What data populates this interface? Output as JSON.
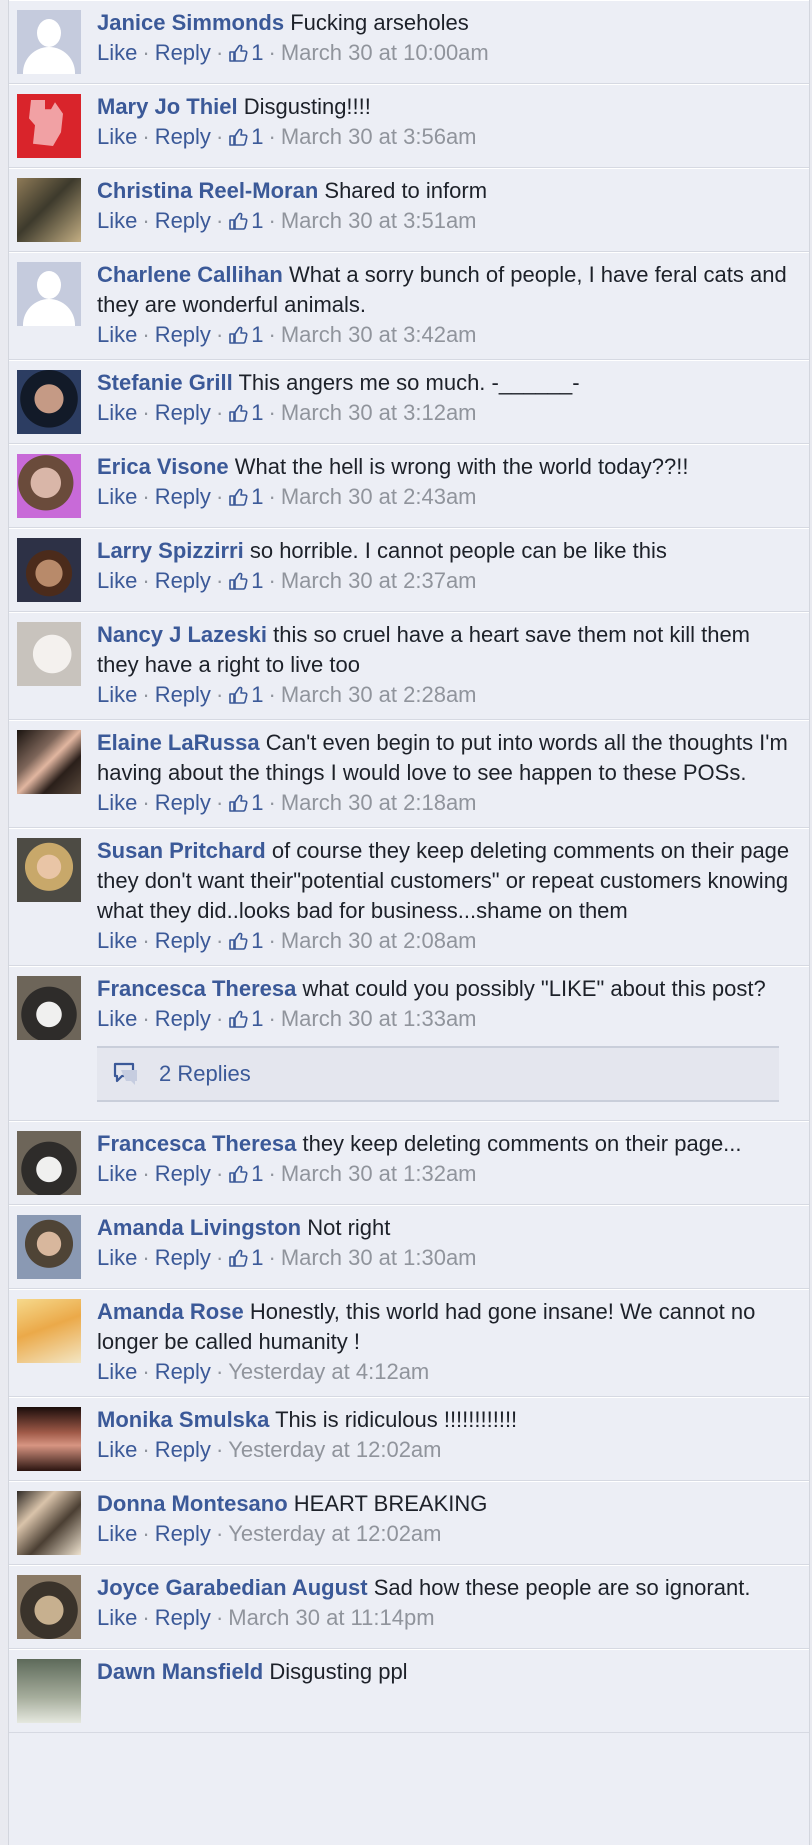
{
  "labels": {
    "like": "Like",
    "reply": "Reply",
    "separator": "·"
  },
  "comments": [
    {
      "name": "Janice Simmonds",
      "text": "Fucking arseholes",
      "likes": "1",
      "time": "March 30 at 10:00am",
      "avatar": "default-avatar"
    },
    {
      "name": "Mary Jo Thiel",
      "text": "Disgusting!!!!",
      "likes": "1",
      "time": "March 30 at 3:56am",
      "avatar": "red-equality-avatar"
    },
    {
      "name": "Christina Reel-Moran",
      "text": "Shared to inform",
      "likes": "1",
      "time": "March 30 at 3:51am",
      "avatar": "couple-photo-avatar"
    },
    {
      "name": "Charlene Callihan",
      "text": "What a sorry bunch of people, I have feral cats and they are wonderful animals.",
      "likes": "1",
      "time": "March 30 at 3:42am",
      "avatar": "default-avatar"
    },
    {
      "name": "Stefanie Grill",
      "text": "This angers me so much. -______-",
      "likes": "1",
      "time": "March 30 at 3:12am",
      "avatar": "woman-photo-avatar"
    },
    {
      "name": "Erica Visone",
      "text": "What the hell is wrong with the world today??!!",
      "likes": "1",
      "time": "March 30 at 2:43am",
      "avatar": "woman-photo-avatar"
    },
    {
      "name": "Larry Spizzirri",
      "text": "so horrible. I cannot people can be like this",
      "likes": "1",
      "time": "March 30 at 2:37am",
      "avatar": "man-photo-avatar"
    },
    {
      "name": "Nancy J Lazeski",
      "text": "this so cruel have a heart save them not kill them they have a right to live too",
      "likes": "1",
      "time": "March 30 at 2:28am",
      "avatar": "dog-photo-avatar"
    },
    {
      "name": "Elaine LaRussa",
      "text": "Can't even begin to put into words all the thoughts I'm having about the things I would love to see happen to these POSs.",
      "likes": "1",
      "time": "March 30 at 2:18am",
      "avatar": "woman-photo-avatar"
    },
    {
      "name": "Susan Pritchard",
      "text": "of course they keep deleting comments on their page they don't want their\"potential customers\" or repeat customers knowing what they did..looks bad for business...shame on them",
      "likes": "1",
      "time": "March 30 at 2:08am",
      "avatar": "woman-photo-avatar"
    },
    {
      "name": "Francesca Theresa",
      "text": "what could you possibly \"LIKE\" about this post?",
      "likes": "1",
      "time": "March 30 at 1:33am",
      "avatar": "cat-photo-avatar",
      "replies": "2 Replies"
    },
    {
      "name": "Francesca Theresa",
      "text": "they keep deleting comments on their page...",
      "likes": "1",
      "time": "March 30 at 1:32am",
      "avatar": "cat-photo-avatar"
    },
    {
      "name": "Amanda Livingston",
      "text": "Not right",
      "likes": "1",
      "time": "March 30 at 1:30am",
      "avatar": "woman-photo-avatar"
    },
    {
      "name": "Amanda Rose",
      "text": "Honestly, this world had gone insane! We cannot no longer be called humanity !",
      "likes": "",
      "time": "Yesterday at 4:12am",
      "avatar": "book-cover-avatar"
    },
    {
      "name": "Monika Smulska",
      "text": "This is ridiculous !!!!!!!!!!!!",
      "likes": "",
      "time": "Yesterday at 12:02am",
      "avatar": "woman-photo-avatar"
    },
    {
      "name": "Donna Montesano",
      "text": "HEART BREAKING",
      "likes": "",
      "time": "Yesterday at 12:02am",
      "avatar": "group-photo-avatar"
    },
    {
      "name": "Joyce Garabedian August",
      "text": "Sad how these people are so ignorant.",
      "likes": "",
      "time": "March 30 at 11:14pm",
      "avatar": "cat-photo-avatar"
    },
    {
      "name": "Dawn Mansfield",
      "text": "Disgusting ppl",
      "likes": "",
      "time": "",
      "avatar": "landscape-photo-avatar"
    }
  ]
}
